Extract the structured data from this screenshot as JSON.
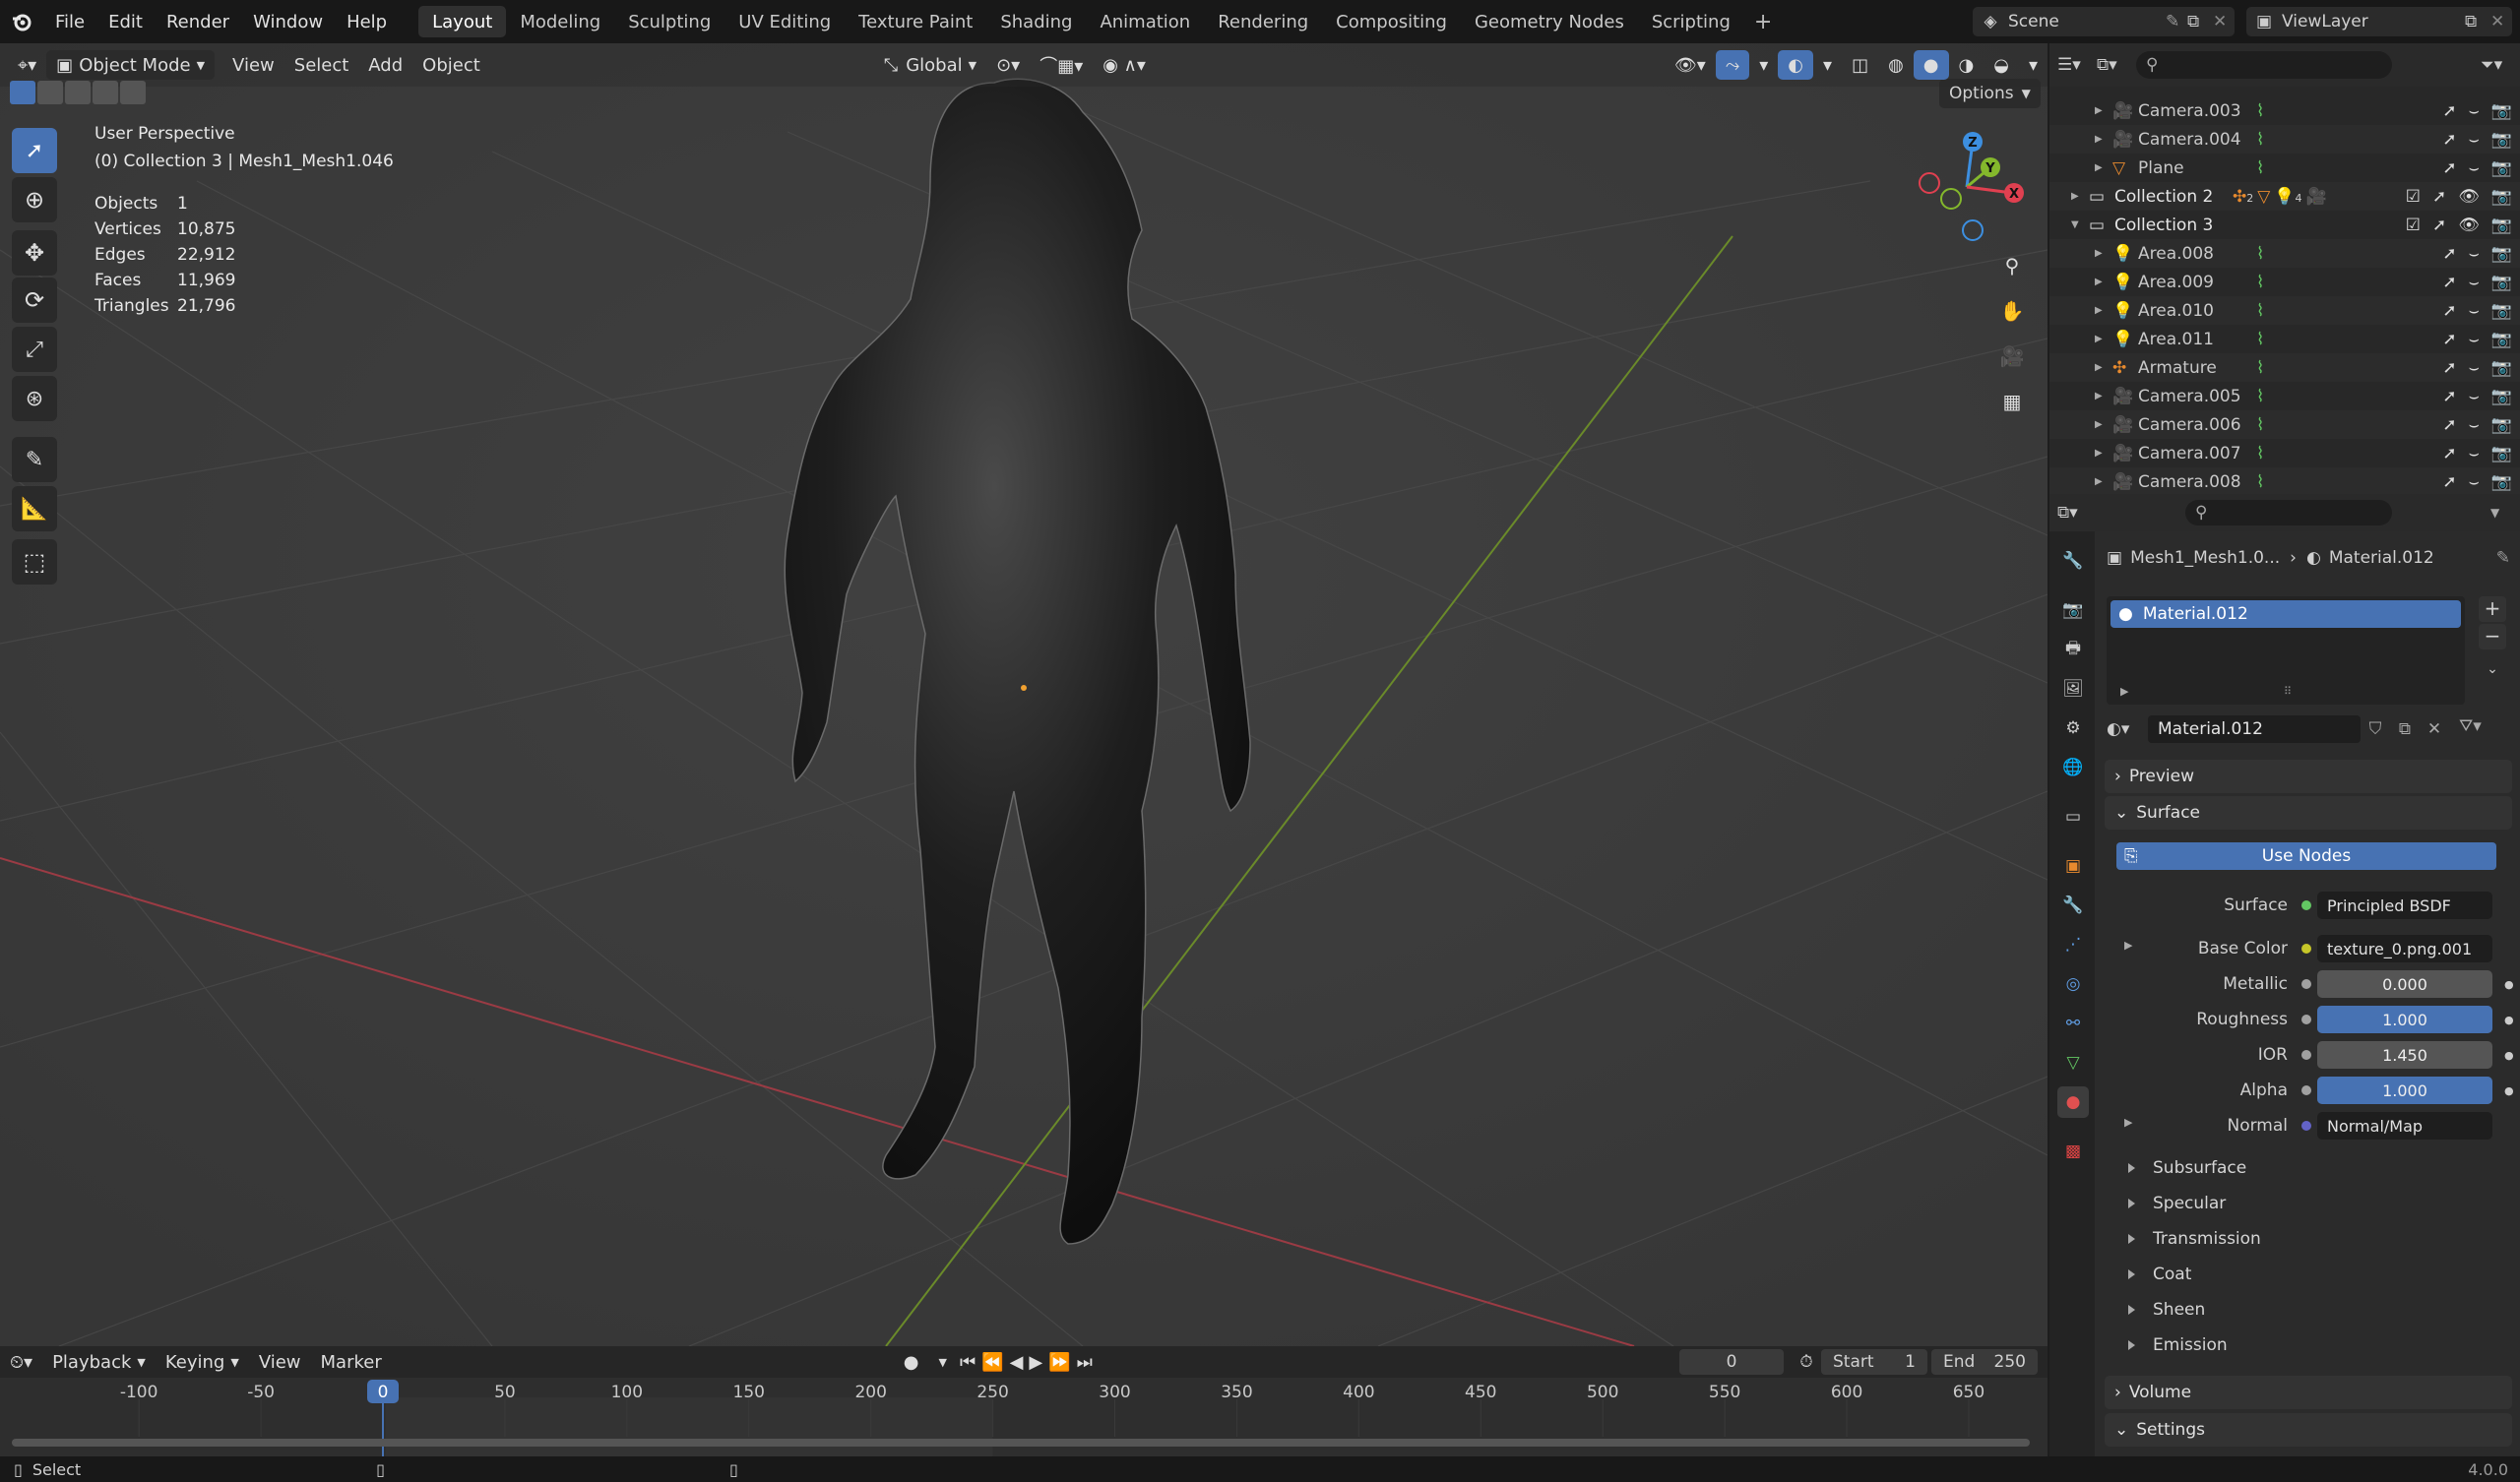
{
  "topbar": {
    "menus": [
      "File",
      "Edit",
      "Render",
      "Window",
      "Help"
    ],
    "workspaces": [
      "Layout",
      "Modeling",
      "Sculpting",
      "UV Editing",
      "Texture Paint",
      "Shading",
      "Animation",
      "Rendering",
      "Compositing",
      "Geometry Nodes",
      "Scripting"
    ],
    "active_workspace": "Layout",
    "scene": "Scene",
    "view_layer": "ViewLayer"
  },
  "viewport_header": {
    "mode": "Object Mode",
    "menus": [
      "View",
      "Select",
      "Add",
      "Object"
    ],
    "orientation": "Global",
    "options": "Options"
  },
  "viewport": {
    "view_name": "User Perspective",
    "collection_info": "(0) Collection 3 | Mesh1_Mesh1.046",
    "stats": [
      {
        "label": "Objects",
        "value": "1"
      },
      {
        "label": "Vertices",
        "value": "10,875"
      },
      {
        "label": "Edges",
        "value": "22,912"
      },
      {
        "label": "Faces",
        "value": "11,969"
      },
      {
        "label": "Triangles",
        "value": "21,796"
      }
    ],
    "gizmo_axes": [
      "Z",
      "Y",
      "X"
    ]
  },
  "outliner": {
    "rows": [
      {
        "name": "Camera.003",
        "type": "camera",
        "indent": 2
      },
      {
        "name": "Camera.004",
        "type": "camera",
        "indent": 2
      },
      {
        "name": "Plane",
        "type": "mesh",
        "indent": 2
      },
      {
        "name": "Collection 2",
        "type": "collection",
        "indent": 1,
        "badge": "2",
        "badge2": "4"
      },
      {
        "name": "Collection 3",
        "type": "collection",
        "indent": 1,
        "expanded": true
      },
      {
        "name": "Area.008",
        "type": "light",
        "indent": 2
      },
      {
        "name": "Area.009",
        "type": "light",
        "indent": 2
      },
      {
        "name": "Area.010",
        "type": "light",
        "indent": 2
      },
      {
        "name": "Area.011",
        "type": "light",
        "indent": 2
      },
      {
        "name": "Armature",
        "type": "armature",
        "indent": 2
      },
      {
        "name": "Camera.005",
        "type": "camera",
        "indent": 2
      },
      {
        "name": "Camera.006",
        "type": "camera",
        "indent": 2
      },
      {
        "name": "Camera.007",
        "type": "camera",
        "indent": 2
      },
      {
        "name": "Camera.008",
        "type": "camera",
        "indent": 2
      }
    ]
  },
  "properties": {
    "breadcrumb_object": "Mesh1_Mesh1.0...",
    "breadcrumb_material": "Material.012",
    "slot": "Material.012",
    "material_name": "Material.012",
    "panels": {
      "preview": "Preview",
      "surface": "Surface",
      "use_nodes": "Use Nodes",
      "volume": "Volume",
      "settings": "Settings"
    },
    "surface_rows": [
      {
        "label": "Surface",
        "value": "Principled BSDF",
        "kind": "link",
        "dot": "#63c763"
      },
      {
        "label": "Base Color",
        "value": "texture_0.png.001",
        "kind": "link",
        "dot": "#c7c729",
        "expand": true
      },
      {
        "label": "Metallic",
        "value": "0.000",
        "kind": "num",
        "fill": 0.0,
        "dot": "#a1a1a1"
      },
      {
        "label": "Roughness",
        "value": "1.000",
        "kind": "num",
        "fill": 1.0,
        "dot": "#a1a1a1"
      },
      {
        "label": "IOR",
        "value": "1.450",
        "kind": "num",
        "fill": 0.0,
        "dot": "#a1a1a1"
      },
      {
        "label": "Alpha",
        "value": "1.000",
        "kind": "num",
        "fill": 1.0,
        "dot": "#a1a1a1"
      },
      {
        "label": "Normal",
        "value": "Normal/Map",
        "kind": "link",
        "dot": "#6363c7",
        "expand": true
      }
    ],
    "subpanels": [
      "Subsurface",
      "Specular",
      "Transmission",
      "Coat",
      "Sheen",
      "Emission"
    ]
  },
  "timeline": {
    "menus": [
      "Playback",
      "Keying",
      "View",
      "Marker"
    ],
    "current_frame": "0",
    "start_label": "Start",
    "start": "1",
    "end_label": "End",
    "end": "250",
    "ticks": [
      "-100",
      "-50",
      "0",
      "50",
      "100",
      "150",
      "200",
      "250",
      "300",
      "350",
      "400",
      "450",
      "500",
      "550",
      "600",
      "650"
    ]
  },
  "status": {
    "left": "Select",
    "version": "4.0.0"
  },
  "colors": {
    "accent": "#4772b3",
    "x_axis": "#e04050",
    "y_axis": "#84b82c",
    "z_axis": "#3d8fe0"
  }
}
